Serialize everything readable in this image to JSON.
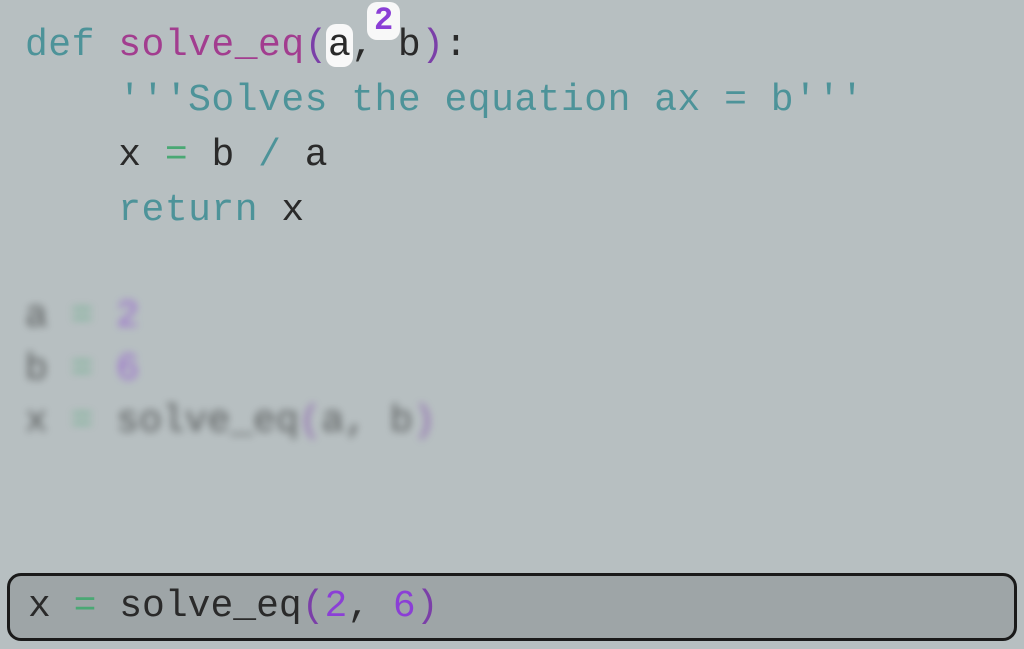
{
  "annotation": {
    "param_a_value": "2"
  },
  "code": {
    "line1": {
      "def": "def ",
      "fn_name": "solve_eq",
      "open_paren": "(",
      "param_a": "a",
      "comma": ", ",
      "param_b": "b",
      "close_paren": ")",
      "colon": ":"
    },
    "line2": {
      "indent": "    ",
      "docstring": "'''Solves the equation ax = b'''"
    },
    "line3": {
      "indent": "    ",
      "var_x": "x",
      "space1": " ",
      "eq": "=",
      "space2": " ",
      "var_b": "b",
      "space3": " ",
      "div": "/",
      "space4": " ",
      "var_a": "a"
    },
    "line4": {
      "indent": "    ",
      "return": "return ",
      "var_x": "x"
    }
  },
  "blurred": {
    "line1": {
      "var": "a",
      "sp1": " ",
      "eq": "=",
      "sp2": " ",
      "val": "2"
    },
    "line2": {
      "var": "b",
      "sp1": " ",
      "eq": "=",
      "sp2": " ",
      "val": "6"
    },
    "line3": {
      "var": "x",
      "sp1": " ",
      "eq": "=",
      "sp2": " ",
      "fn": "solve_eq",
      "op": "(",
      "a": "a",
      "comma": ", ",
      "b": "b",
      "cp": ")"
    }
  },
  "bottom": {
    "var_x": "x",
    "sp1": " ",
    "eq": "=",
    "sp2": " ",
    "fn_name": "solve_eq",
    "open_paren": "(",
    "arg1": "2",
    "comma": ", ",
    "arg2": "6",
    "close_paren": ")"
  }
}
